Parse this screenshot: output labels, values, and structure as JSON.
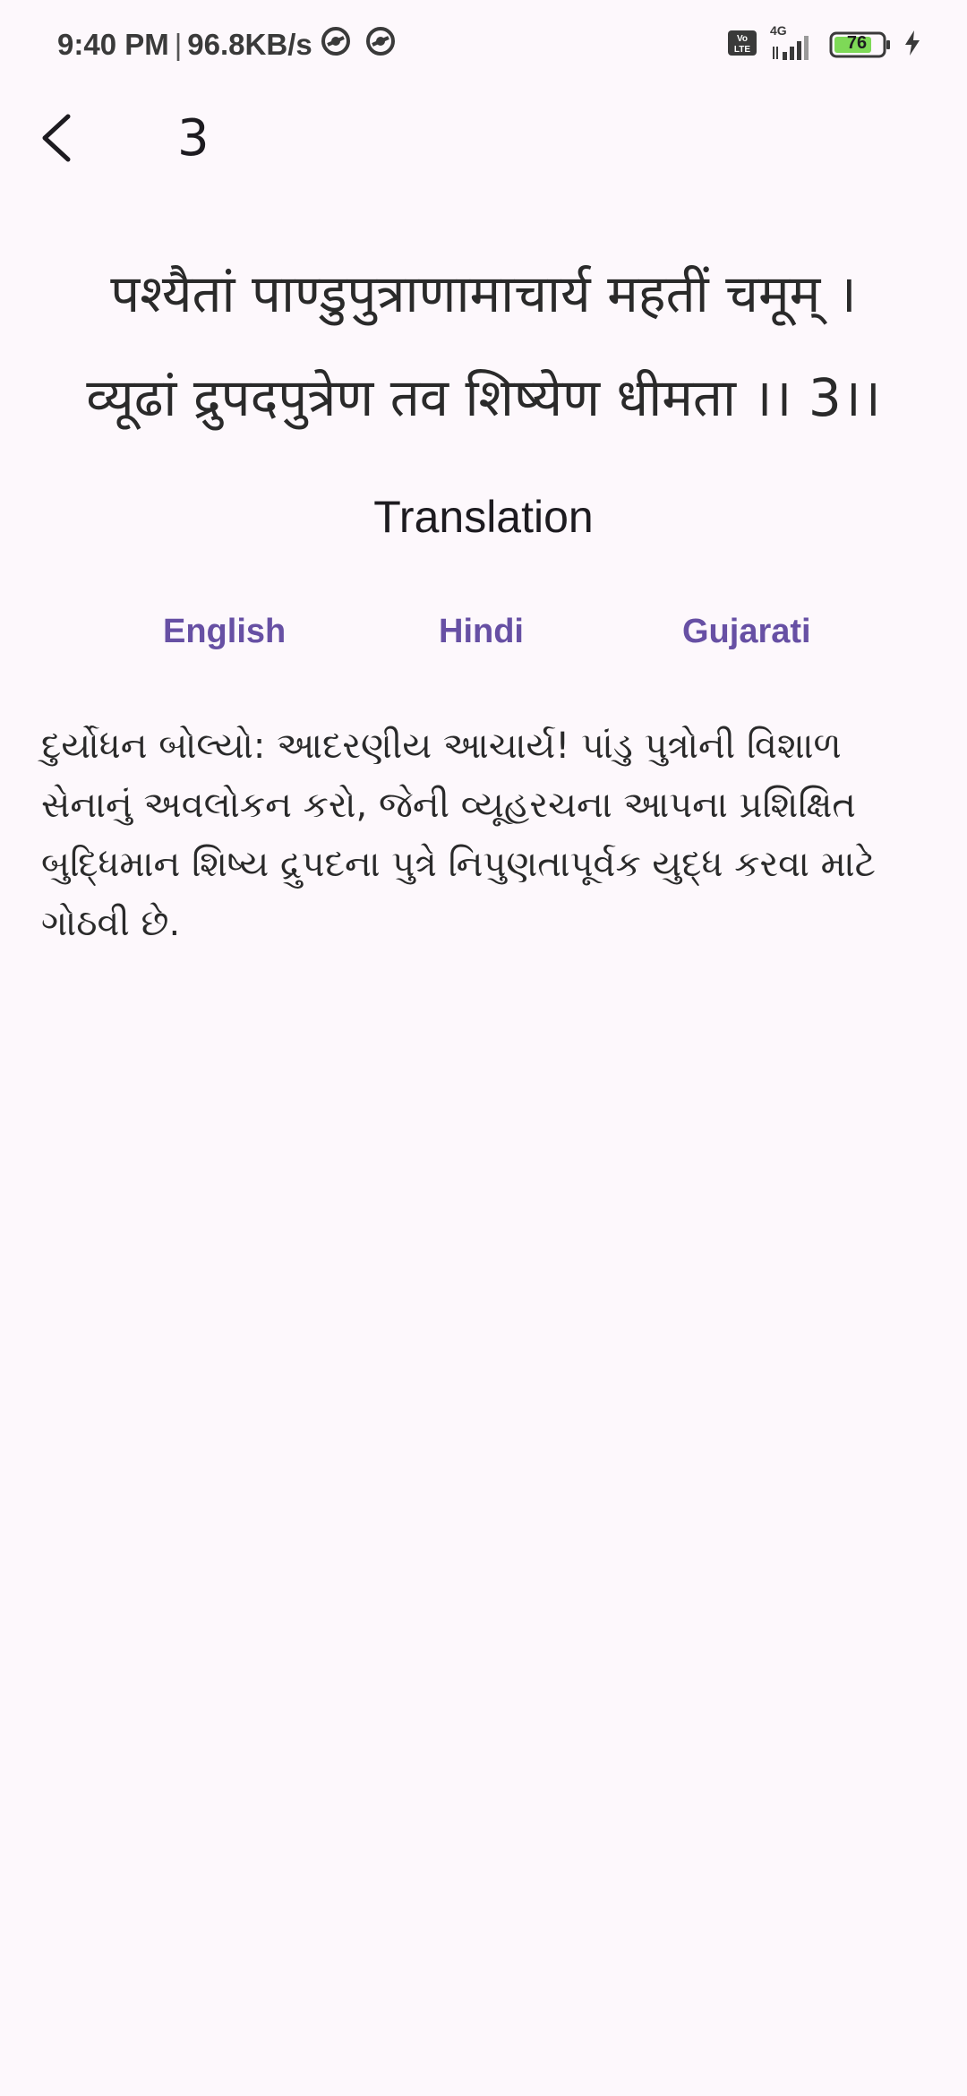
{
  "status_bar": {
    "time": "9:40 PM",
    "separator": "|",
    "network_speed": "96.8KB/s",
    "network_type": "4G",
    "volte_label": "Vo LTE",
    "battery_level": "76"
  },
  "app_bar": {
    "title": "3"
  },
  "verse": {
    "line1": "पश्यैतां पाण्डुपुत्राणामाचार्य महतीं चमूम् ।",
    "line2": "व्यूढां द्रुपदपुत्रेण तव शिष्येण धीमता ।। 3।।"
  },
  "translation": {
    "heading": "Translation",
    "tabs": [
      "English",
      "Hindi",
      "Gujarati"
    ],
    "text": "દુર્યોધન બોલ્યો: આદરણીય આચાર્ય! પાંડુ પુત્રોની વિશાળ સેનાનું અવલોકન કરો, જેની વ્યૂહરચના આપના પ્રશિક્ષિત બુદ્ધિમાન શિષ્ય દ્રુપદના પુત્રે નિપુણતાપૂર્વક યુદ્ધ કરવા માટે ગોઠવી છે."
  },
  "colors": {
    "background": "#fdf8fc",
    "accent": "#6750a4",
    "battery_fill": "#7ed957"
  }
}
